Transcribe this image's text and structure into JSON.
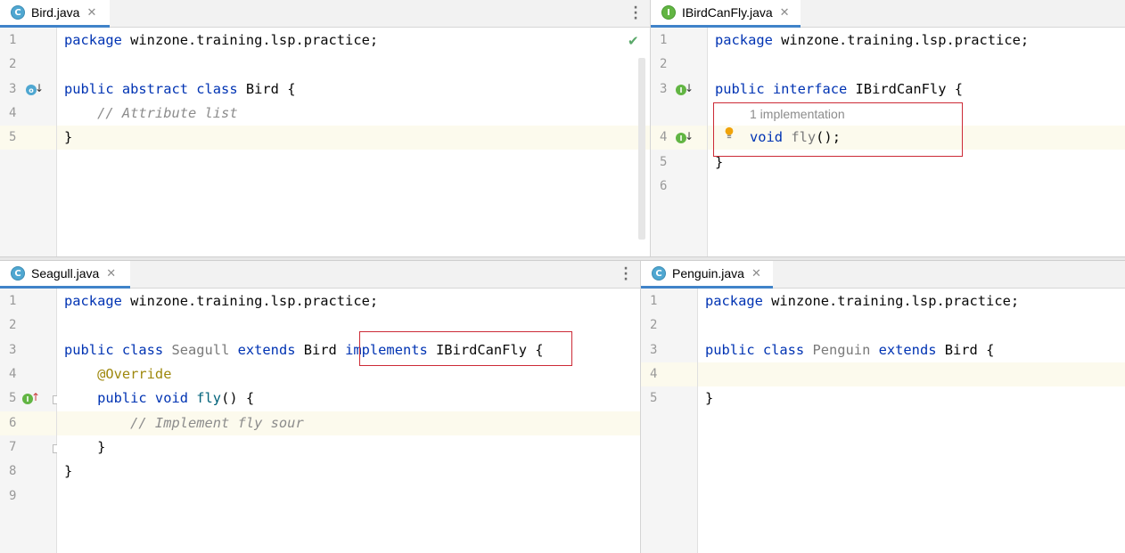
{
  "panes": {
    "bird": {
      "tab": {
        "label": "Bird.java",
        "icon": "class-icon",
        "icon_letter": "C",
        "close": "✕"
      },
      "lines": [
        "1",
        "2",
        "3",
        "4",
        "5"
      ],
      "code": {
        "l1_kw": "package",
        "l1_rest": " winzone.training.lsp.practice;",
        "l3_kw": "public abstract class",
        "l3_rest": " Bird {",
        "l4_comment": "    // Attribute list",
        "l5": "}"
      }
    },
    "ibirdcanfly": {
      "tab": {
        "label": "IBirdCanFly.java",
        "icon": "interface-icon",
        "icon_letter": "I",
        "close": "✕"
      },
      "lines": [
        "1",
        "2",
        "3",
        "4",
        "5",
        "6"
      ],
      "code": {
        "l1_kw": "package",
        "l1_rest": " winzone.training.lsp.practice;",
        "l3_kw": "public interface",
        "l3_rest": " IBirdCanFly {",
        "hint": "1 implementation",
        "l4_kw": "void",
        "l4_fn": " fly",
        "l4_rest": "();",
        "l5": "}"
      }
    },
    "seagull": {
      "tab": {
        "label": "Seagull.java",
        "icon": "class-icon",
        "icon_letter": "C",
        "close": "✕"
      },
      "lines": [
        "1",
        "2",
        "3",
        "4",
        "5",
        "6",
        "7",
        "8",
        "9"
      ],
      "code": {
        "l1_kw": "package",
        "l1_rest": " winzone.training.lsp.practice;",
        "l3_kw1": "public class",
        "l3_name": " Seagull",
        "l3_kw2": " extends",
        "l3_bird": " Bird ",
        "l3_kw3": "implements",
        "l3_iface": " IBirdCanFly",
        "l3_end": " {",
        "l4_ann": "    @Override",
        "l5_kw": "    public void",
        "l5_fn": " fly",
        "l5_rest": "() {",
        "l6_comment": "        // Implement fly sour",
        "l7": "    }",
        "l8": "}"
      }
    },
    "penguin": {
      "tab": {
        "label": "Penguin.java",
        "icon": "class-icon",
        "icon_letter": "C",
        "close": "✕"
      },
      "lines": [
        "1",
        "2",
        "3",
        "4",
        "5"
      ],
      "code": {
        "l1_kw": "package",
        "l1_rest": " winzone.training.lsp.practice;",
        "l3_kw1": "public class",
        "l3_name": " Penguin",
        "l3_kw2": " extends",
        "l3_rest": " Bird {",
        "l5": "}"
      }
    }
  },
  "colors": {
    "keyword": "#0033b3",
    "comment": "#8c8c8c",
    "annotation": "#9e880d",
    "highlight": "#fcfaed",
    "callout": "#cc2a36",
    "tab_underline": "#4083c9"
  }
}
